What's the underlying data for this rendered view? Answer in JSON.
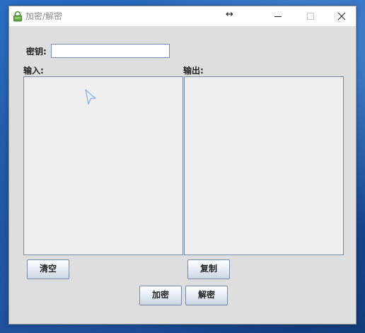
{
  "window": {
    "title": "加密/解密",
    "icon": "lock-icon",
    "controls": [
      "minimize-icon",
      "maximize-icon",
      "close-icon"
    ]
  },
  "form": {
    "key_label": "密钥:",
    "key_value": "",
    "input_label": "输入:",
    "input_value": "",
    "output_label": "输出:",
    "output_value": ""
  },
  "buttons": {
    "clear": "清空",
    "copy": "复制",
    "encrypt": "加密",
    "decrypt": "解密"
  },
  "colors": {
    "window_bg": "#dedede",
    "field_border": "#7a8ba8",
    "icon_green": "#4a8f2a"
  }
}
